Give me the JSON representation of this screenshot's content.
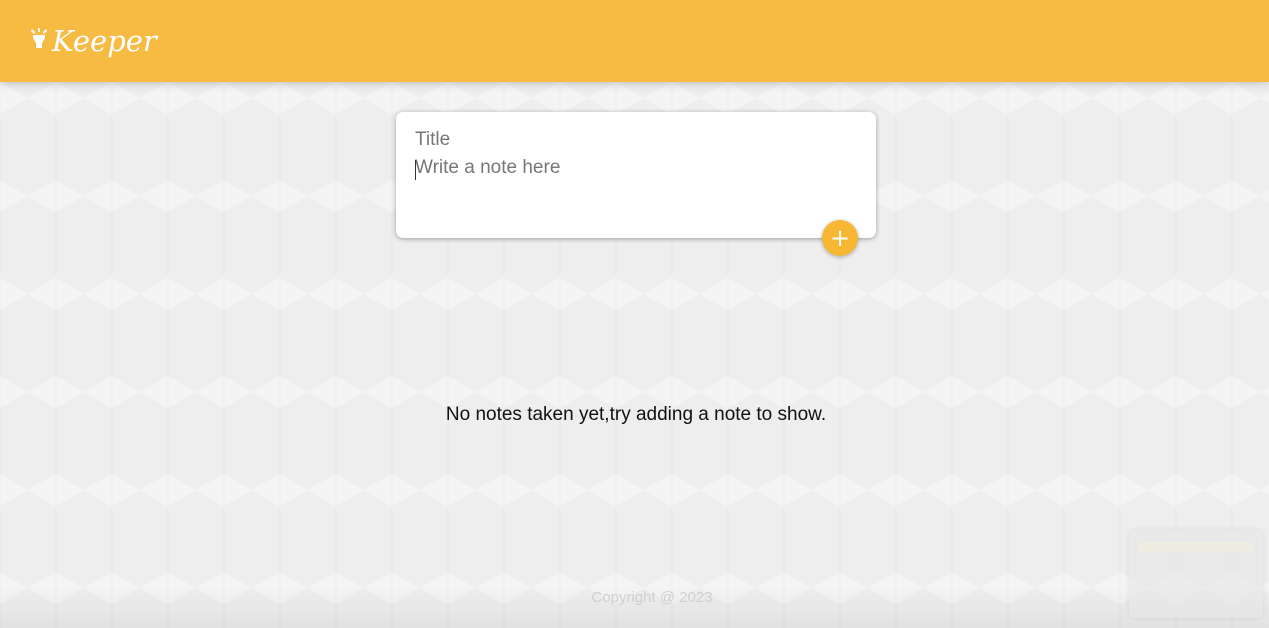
{
  "header": {
    "brand_name": "Keeper",
    "brand_icon": "lightbulb-icon",
    "background_color": "#f7bb43"
  },
  "note_form": {
    "title_placeholder": "Title",
    "content_placeholder": "Write a note here",
    "add_button_label": "+",
    "add_button_color": "#f7b733"
  },
  "main": {
    "empty_message": "No notes taken yet,try adding a note to show."
  },
  "footer": {
    "copyright": "Copyright @ 2023"
  }
}
